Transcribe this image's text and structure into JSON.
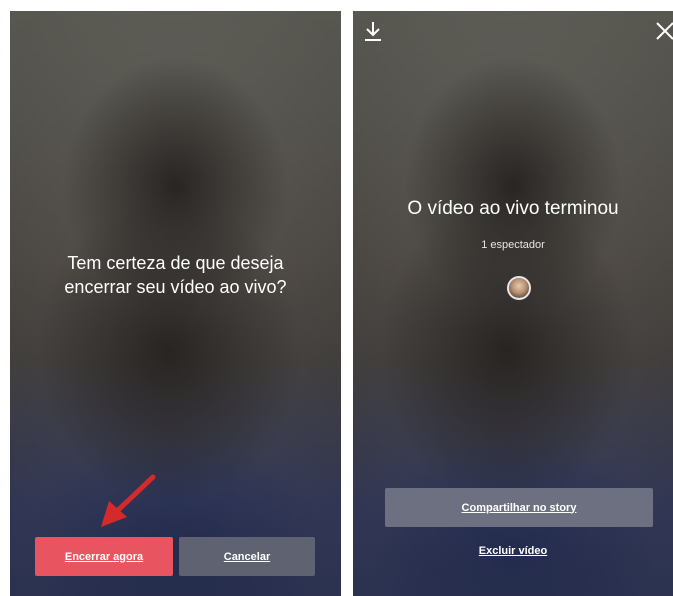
{
  "left_screen": {
    "question": "Tem certeza de que deseja\nencerrar seu vídeo ao vivo?",
    "end_now_label": "Encerrar agora",
    "cancel_label": "Cancelar",
    "end_button_color": "#e85560",
    "annotation_arrow_color": "#d42a2a"
  },
  "right_screen": {
    "download_icon": "download-icon",
    "close_icon": "close-icon",
    "title": "O vídeo ao vivo terminou",
    "viewers": "1 espectador",
    "share_label": "Compartilhar no story",
    "delete_label": "Excluir vídeo"
  }
}
